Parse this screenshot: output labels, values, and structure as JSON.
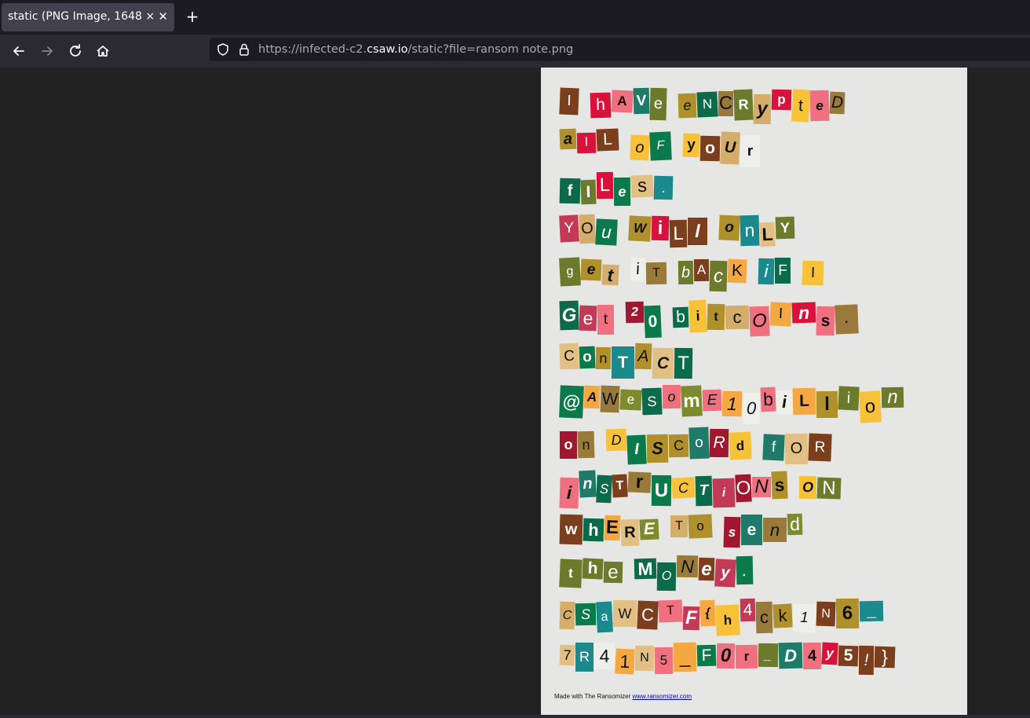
{
  "browser": {
    "tab_title": "static (PNG Image, 1648 × 2504 pixels)",
    "tab_close_icon": "close-icon",
    "url_scheme": "https://",
    "url_sub": "infected-c2.",
    "url_host": "csaw.io",
    "url_path": "/static?file=ransom note.png"
  },
  "note": {
    "lines": [
      "I hAVe eNCRypteD",
      "alL oF yoUr",
      "fILes.",
      "YOu WiLl onLY",
      "get iT bAcK iF I",
      "Get 20 bitcOIns.",
      "ConTACT",
      "@AWeSomE10biLlion",
      "on DISCoRd fOR",
      "inSTrUCTiONs ON",
      "whERE To send",
      "the MONey.",
      "CSaWCTF{h4ck1N6_",
      "7R41N5_F0r_D4y5!}"
    ],
    "footer_text": "Made with The Ransomizer ",
    "footer_link": "www.ransomizer.com"
  }
}
